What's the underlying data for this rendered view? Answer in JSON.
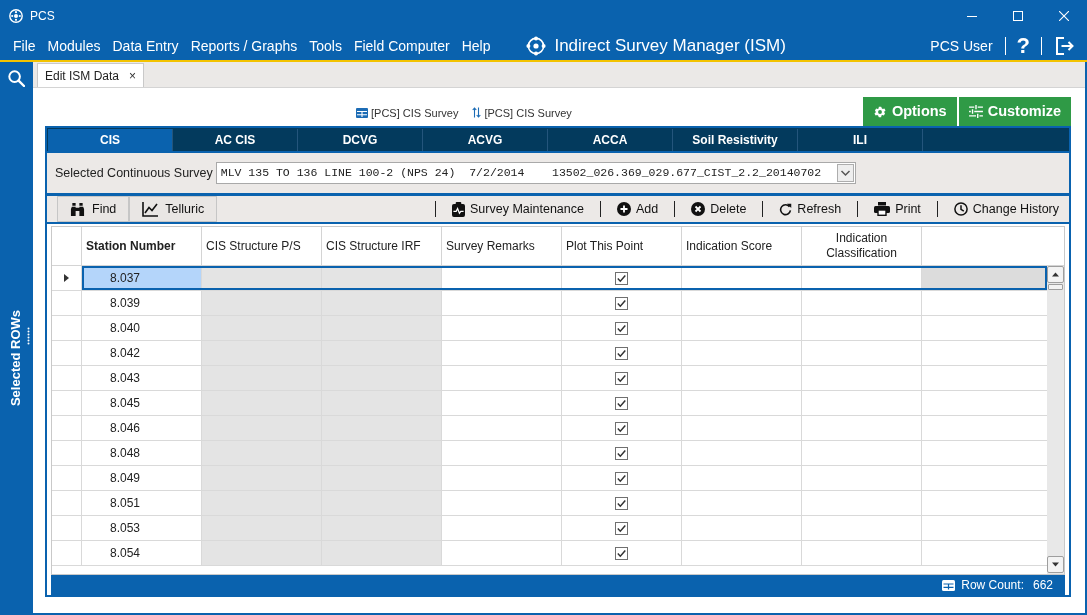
{
  "window": {
    "title": "PCS"
  },
  "menu": [
    "File",
    "Modules",
    "Data Entry",
    "Reports / Graphs",
    "Tools",
    "Field Computer",
    "Help"
  ],
  "app_header": {
    "title": "Indirect Survey Manager (ISM)",
    "user": "PCS User",
    "help": "?"
  },
  "side_panel": {
    "label": "Selected ROWs"
  },
  "document_tabs": [
    {
      "label": "Edit ISM Data",
      "selected": true,
      "close": "×"
    }
  ],
  "source_links": [
    {
      "kind": "table",
      "label": "[PCS] CIS Survey"
    },
    {
      "kind": "relation",
      "label": "[PCS] CIS Survey"
    }
  ],
  "header_buttons": [
    {
      "kind": "options",
      "label": "Options"
    },
    {
      "kind": "customize",
      "label": "Customize"
    }
  ],
  "survey_tabs": [
    {
      "label": "CIS",
      "selected": true
    },
    {
      "label": "AC CIS",
      "selected": false
    },
    {
      "label": "DCVG",
      "selected": false
    },
    {
      "label": "ACVG",
      "selected": false
    },
    {
      "label": "ACCA",
      "selected": false
    },
    {
      "label": "Soil Resistivity",
      "selected": false
    },
    {
      "label": "ILI",
      "selected": false
    }
  ],
  "survey_selector": {
    "label": "Selected Continuous Survey",
    "value": "MLV 135 TO 136 LINE 100-2 (NPS 24)  7/2/2014    13502_026.369_029.677_CIST_2.2_20140702"
  },
  "toolbar": {
    "left": [
      {
        "kind": "find",
        "label": "Find"
      },
      {
        "kind": "telluric",
        "label": "Telluric"
      }
    ],
    "right": [
      {
        "kind": "maintenance",
        "label": "Survey Maintenance"
      },
      {
        "kind": "add",
        "label": "Add"
      },
      {
        "kind": "delete",
        "label": "Delete"
      },
      {
        "kind": "refresh",
        "label": "Refresh"
      },
      {
        "kind": "print",
        "label": "Print"
      },
      {
        "kind": "history",
        "label": "Change History"
      }
    ]
  },
  "table": {
    "columns": [
      {
        "label": "Station Number",
        "kind": "text",
        "bold": true,
        "centered": false,
        "read_only": false
      },
      {
        "label": "CIS Structure P/S",
        "kind": "text",
        "bold": false,
        "centered": false,
        "read_only": true
      },
      {
        "label": "CIS Structure IRF",
        "kind": "text",
        "bold": false,
        "centered": false,
        "read_only": true
      },
      {
        "label": "Survey Remarks",
        "kind": "text",
        "bold": false,
        "centered": false,
        "read_only": false
      },
      {
        "label": "Plot This Point",
        "kind": "checkbox",
        "bold": false,
        "centered": false,
        "read_only": false
      },
      {
        "label": "Indication Score",
        "kind": "text",
        "bold": false,
        "centered": false,
        "read_only": false
      },
      {
        "label": "Indication Classification",
        "kind": "text",
        "bold": false,
        "centered": true,
        "read_only": false
      }
    ],
    "rows": [
      {
        "station_number": "8.037",
        "plot_this_point": true,
        "selected": true
      },
      {
        "station_number": "8.039",
        "plot_this_point": true,
        "selected": false
      },
      {
        "station_number": "8.040",
        "plot_this_point": true,
        "selected": false
      },
      {
        "station_number": "8.042",
        "plot_this_point": true,
        "selected": false
      },
      {
        "station_number": "8.043",
        "plot_this_point": true,
        "selected": false
      },
      {
        "station_number": "8.045",
        "plot_this_point": true,
        "selected": false
      },
      {
        "station_number": "8.046",
        "plot_this_point": true,
        "selected": false
      },
      {
        "station_number": "8.048",
        "plot_this_point": true,
        "selected": false
      },
      {
        "station_number": "8.049",
        "plot_this_point": true,
        "selected": false
      },
      {
        "station_number": "8.051",
        "plot_this_point": true,
        "selected": false
      },
      {
        "station_number": "8.053",
        "plot_this_point": true,
        "selected": false
      },
      {
        "station_number": "8.054",
        "plot_this_point": true,
        "selected": false
      }
    ]
  },
  "status_bar": {
    "label": "Row Count:",
    "value": "662"
  }
}
